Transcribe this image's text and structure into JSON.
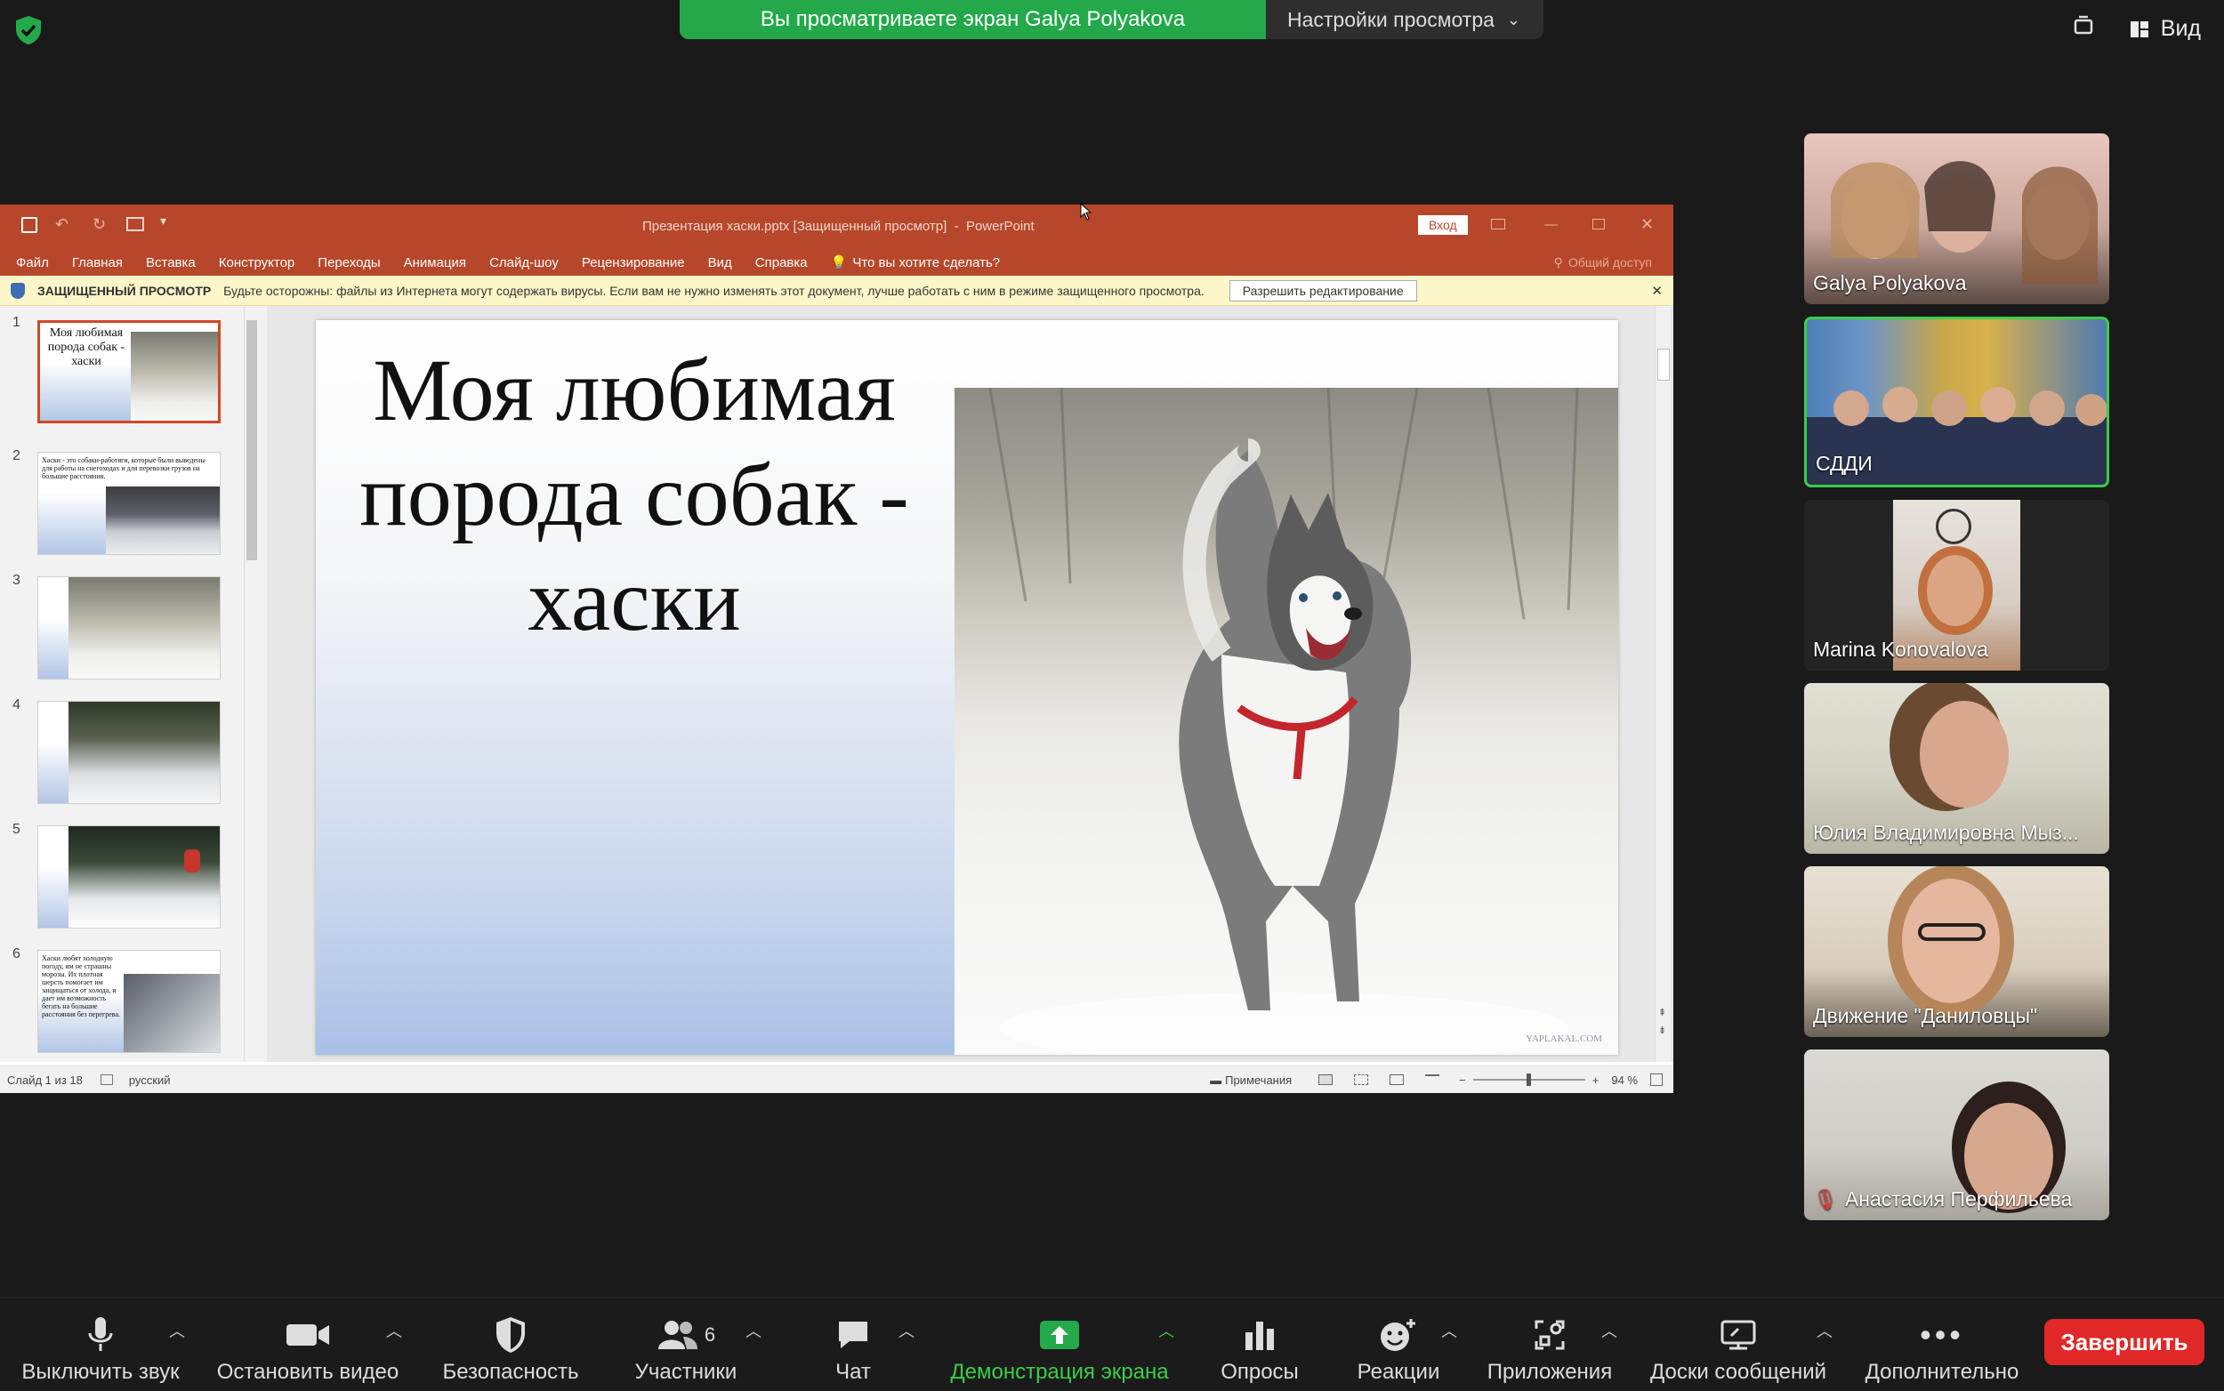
{
  "zoom_top": {
    "banner": "Вы просматриваете экран Galya Polyakova",
    "view_settings": "Настройки просмотра",
    "view_label": "Вид"
  },
  "powerpoint": {
    "window_title": "Презентация хаски.pptx [Защищенный просмотр]  -  PowerPoint",
    "signin": "Вход",
    "menu": [
      "Файл",
      "Главная",
      "Вставка",
      "Конструктор",
      "Переходы",
      "Анимация",
      "Слайд-шоу",
      "Рецензирование",
      "Вид",
      "Справка"
    ],
    "tell_me": "Что вы хотите сделать?",
    "share": "Общий доступ",
    "protected_label": "ЗАЩИЩЕННЫЙ ПРОСМОТР",
    "protected_text": "Будьте осторожны: файлы из Интернета могут содержать вирусы. Если вам не нужно изменять этот документ, лучше работать с ним в режиме защищенного просмотра.",
    "enable_editing": "Разрешить редактирование",
    "thumbnails": [
      {
        "num": "1",
        "text": "Моя любимая порода собак - хаски"
      },
      {
        "num": "2",
        "text": "Хаски - это собаки-работяги, которые были выведены для работы на снегоходах и для перевозки грузов на большие расстояния."
      },
      {
        "num": "3",
        "text": ""
      },
      {
        "num": "4",
        "text": ""
      },
      {
        "num": "5",
        "text": ""
      },
      {
        "num": "6",
        "text": "Хаски любят холодную погоду, им не страшны морозы. Их плотная шерсть помогает им защищаться от холода, и дает им возможность бегать на большие расстояния без перегрева."
      }
    ],
    "slide_title": "Моя любимая порода собак - хаски",
    "watermark": "YAPLAKAL.COM",
    "status": {
      "slide_of": "Слайд 1 из 18",
      "language": "русский",
      "notes": "Примечания",
      "zoom": "94 %"
    }
  },
  "participants": [
    {
      "name": "Galya Polyakova",
      "muted": false
    },
    {
      "name": "СДДИ",
      "muted": false
    },
    {
      "name": "Marina Konovalova",
      "muted": false
    },
    {
      "name": "Юлия Владимировна Мыз...",
      "muted": false
    },
    {
      "name": "Движение \"Даниловцы\"",
      "muted": false
    },
    {
      "name": "Анастасия Перфильева",
      "muted": true
    }
  ],
  "toolbar": {
    "mute": "Выключить звук",
    "video": "Остановить видео",
    "security": "Безопасность",
    "participants": "Участники",
    "participants_count": "6",
    "chat": "Чат",
    "share": "Демонстрация экрана",
    "polls": "Опросы",
    "reactions": "Реакции",
    "apps": "Приложения",
    "whiteboards": "Доски сообщений",
    "more": "Дополнительно",
    "end": "Завершить"
  },
  "colors": {
    "accent_green": "#23a94a",
    "ppt_red": "#b7472a",
    "end_red": "#e02828",
    "active_speaker": "#3ccd4a"
  }
}
